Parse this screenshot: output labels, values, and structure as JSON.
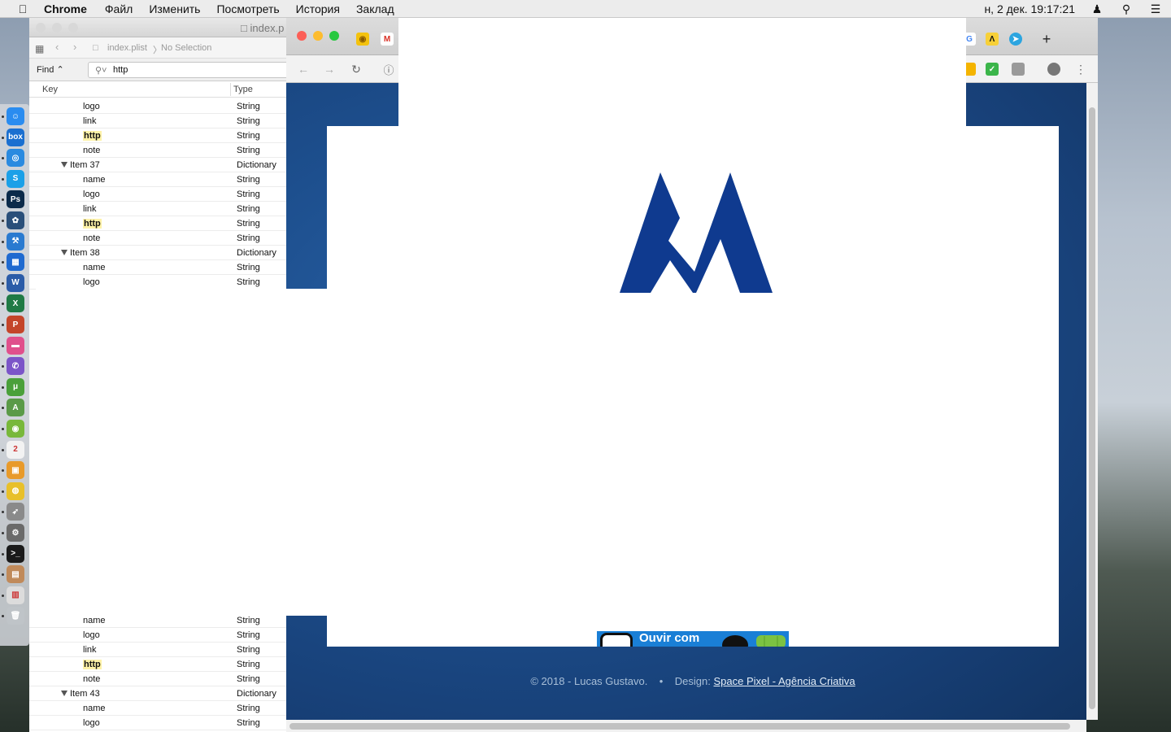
{
  "menubar": {
    "app": "Chrome",
    "items": [
      "Файл",
      "Изменить",
      "Посмотреть",
      "История",
      "Заклад"
    ],
    "clock": "н, 2 дек.  19:17:21"
  },
  "plist": {
    "window_title": "index.p",
    "jump_file": "index.plist",
    "jump_sep": "〉",
    "jump_selection": "No Selection",
    "find_label": "Find ⌃",
    "find_query": "http",
    "col_key": "Key",
    "col_type": "Type",
    "rows_top": [
      {
        "key": "logo",
        "type": "String",
        "level": 1,
        "hl": false
      },
      {
        "key": "link",
        "type": "String",
        "level": 1,
        "hl": false
      },
      {
        "key": "http",
        "type": "String",
        "level": 1,
        "hl": true
      },
      {
        "key": "note",
        "type": "String",
        "level": 1,
        "hl": false
      },
      {
        "key": "Item 37",
        "type": "Dictionary",
        "level": 0,
        "hl": false
      },
      {
        "key": "name",
        "type": "String",
        "level": 1,
        "hl": false
      },
      {
        "key": "logo",
        "type": "String",
        "level": 1,
        "hl": false
      },
      {
        "key": "link",
        "type": "String",
        "level": 1,
        "hl": false
      },
      {
        "key": "http",
        "type": "String",
        "level": 1,
        "hl": true
      },
      {
        "key": "note",
        "type": "String",
        "level": 1,
        "hl": false
      },
      {
        "key": "Item 38",
        "type": "Dictionary",
        "level": 0,
        "hl": false
      },
      {
        "key": "name",
        "type": "String",
        "level": 1,
        "hl": false
      },
      {
        "key": "logo",
        "type": "String",
        "level": 1,
        "hl": false
      }
    ],
    "rows_bottom": [
      {
        "key": "name",
        "type": "String",
        "level": 1,
        "hl": false
      },
      {
        "key": "logo",
        "type": "String",
        "level": 1,
        "hl": false
      },
      {
        "key": "link",
        "type": "String",
        "level": 1,
        "hl": false
      },
      {
        "key": "http",
        "type": "String",
        "level": 1,
        "hl": true
      },
      {
        "key": "note",
        "type": "String",
        "level": 1,
        "hl": false
      },
      {
        "key": "Item 43",
        "type": "Dictionary",
        "level": 0,
        "hl": false
      },
      {
        "key": "name",
        "type": "String",
        "level": 1,
        "hl": false
      },
      {
        "key": "logo",
        "type": "String",
        "level": 1,
        "hl": false
      }
    ]
  },
  "site": {
    "badge_text": "Ouvir com",
    "footer_copy": "© 2018 - Lucas Gustavo.",
    "footer_sep": "•",
    "footer_design_label": "Design:",
    "footer_design_link": "Space Pixel - Agência Criativa",
    "logo_color": "#0f3a8f"
  },
  "dock": [
    {
      "name": "finder",
      "label": "☺",
      "color": "#2a8cf0"
    },
    {
      "name": "box",
      "label": "box",
      "color": "#1a6fd0"
    },
    {
      "name": "safari",
      "label": "◎",
      "color": "#2a8ae0"
    },
    {
      "name": "skype",
      "label": "S",
      "color": "#1aa0e8"
    },
    {
      "name": "photoshop",
      "label": "Ps",
      "color": "#0b2a4a"
    },
    {
      "name": "sourcetree",
      "label": "✿",
      "color": "#2a4f7a"
    },
    {
      "name": "xcode",
      "label": "⚒",
      "color": "#2a7ad0"
    },
    {
      "name": "simulator",
      "label": "▦",
      "color": "#1f6ad0"
    },
    {
      "name": "word",
      "label": "W",
      "color": "#2b5ca8"
    },
    {
      "name": "excel",
      "label": "X",
      "color": "#1f7a45"
    },
    {
      "name": "powerpoint",
      "label": "P",
      "color": "#c4452a"
    },
    {
      "name": "pink-app",
      "label": "▬",
      "color": "#e0508c"
    },
    {
      "name": "viber",
      "label": "✆",
      "color": "#7b55c8"
    },
    {
      "name": "utorrent",
      "label": "μ",
      "color": "#4aa03a"
    },
    {
      "name": "android-studio",
      "label": "A",
      "color": "#5a9a48"
    },
    {
      "name": "android",
      "label": "◉",
      "color": "#78b83a"
    },
    {
      "name": "calendar",
      "label": "2",
      "color": "#f2f2f2"
    },
    {
      "name": "preview",
      "label": "▣",
      "color": "#e89a2a"
    },
    {
      "name": "chrome",
      "label": "◍",
      "color": "#e8c02a"
    },
    {
      "name": "launchpad",
      "label": "➶",
      "color": "#8a8a8a"
    },
    {
      "name": "system-preferences",
      "label": "⚙",
      "color": "#6a6a6a"
    },
    {
      "name": "terminal",
      "label": ">_",
      "color": "#1a1a1a"
    },
    {
      "name": "notes",
      "label": "▤",
      "color": "#c08a5a"
    },
    {
      "name": "document",
      "label": "▥",
      "color": "#dcdcdc"
    },
    {
      "name": "trash",
      "label": "🗑",
      "color": "#bfc4c8"
    }
  ]
}
